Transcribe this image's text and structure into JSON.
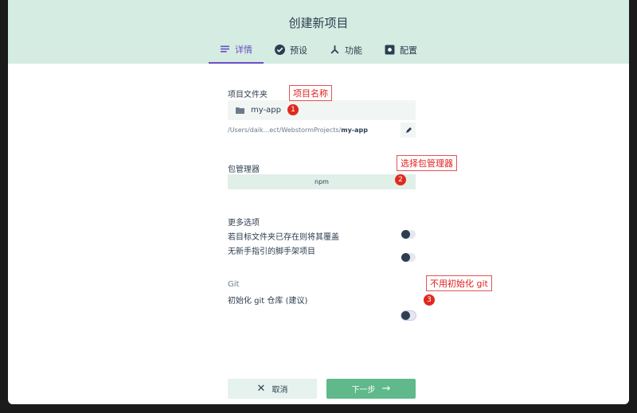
{
  "title": "创建新项目",
  "tabs": [
    {
      "label": "详情",
      "icon": "list-icon"
    },
    {
      "label": "预设",
      "icon": "check-circle-icon"
    },
    {
      "label": "功能",
      "icon": "fork-icon"
    },
    {
      "label": "配置",
      "icon": "settings-icon"
    }
  ],
  "folder": {
    "label": "项目文件夹",
    "value": "my-app",
    "path_prefix": "/Users/daik...ect/WebstormProjects/",
    "path_name": "my-app"
  },
  "package_manager": {
    "label": "包管理器",
    "value": "npm"
  },
  "more": {
    "label": "更多选项",
    "options": [
      {
        "label": "若目标文件夹已存在则将其覆盖",
        "on": false
      },
      {
        "label": "无新手指引的脚手架项目",
        "on": false
      }
    ]
  },
  "git": {
    "label": "Git",
    "option": "初始化 git 仓库 (建议)",
    "on": false
  },
  "annotations": [
    {
      "num": "1",
      "text": "项目名称"
    },
    {
      "num": "2",
      "text": "选择包管理器"
    },
    {
      "num": "3",
      "text": "不用初始化 git"
    }
  ],
  "buttons": {
    "cancel": "取消",
    "next": "下一步"
  },
  "colors": {
    "header": "#d4ece1",
    "accent": "#6a4fc7",
    "primary": "#5fb98a",
    "annotation": "#e02020"
  }
}
